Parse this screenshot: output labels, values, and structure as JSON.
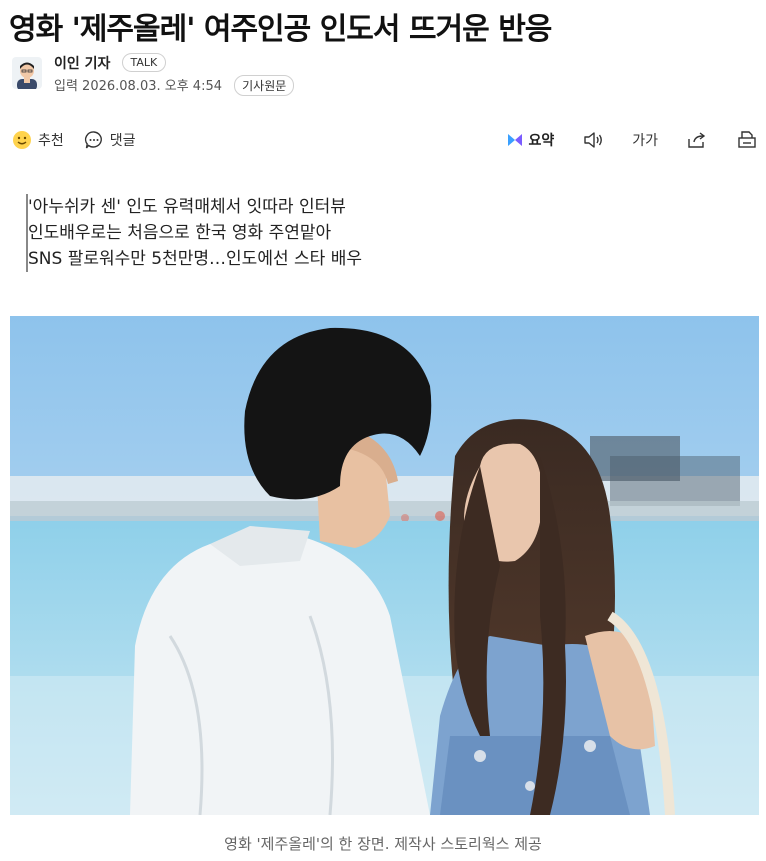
{
  "article": {
    "headline": "영화 '제주올레' 여주인공 인도서 뜨거운 반응",
    "author": "이인 기자",
    "talk_badge": "TALK",
    "timestamp": "입력 2026.08.03. 오후 4:54",
    "original_link": "기사원문"
  },
  "toolbar": {
    "recommend": "추천",
    "comment": "댓글",
    "summary": "요약",
    "fontsize": "가가"
  },
  "summary_lines": [
    "'아누쉬카 센' 인도 유력매체서 잇따라 인터뷰",
    "인도배우로는 처음으로 한국 영화 주연맡아",
    "SNS 팔로워수만 5천만명…인도에선 스타 배우"
  ],
  "photo": {
    "caption": "영화 '제주올레'의 한 장면. 제작사 스토리웍스 제공"
  }
}
